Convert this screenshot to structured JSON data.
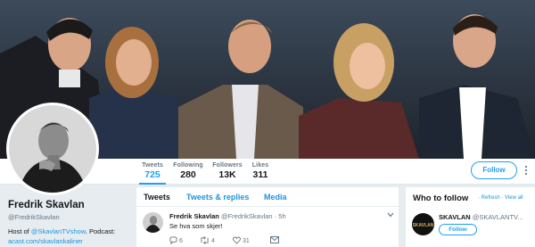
{
  "profile": {
    "name": "Fredrik Skavlan",
    "handle": "@FredrikSkavlan",
    "bio_prefix": "Host of ",
    "bio_link": "@SkavlanTVshow",
    "bio_middle": ". Podcast:",
    "bio_url": "acast.com/skavlankaliner"
  },
  "stats": [
    {
      "label": "Tweets",
      "value": "725"
    },
    {
      "label": "Following",
      "value": "280"
    },
    {
      "label": "Followers",
      "value": "13K"
    },
    {
      "label": "Likes",
      "value": "311"
    }
  ],
  "follow_label": "Follow",
  "more_icon": "vertical-ellipsis-icon",
  "timeline": {
    "tabs": [
      "Tweets",
      "Tweets & replies",
      "Media"
    ],
    "tweet": {
      "name": "Fredrik Skavlan",
      "handle": "@FredrikSkavlan",
      "dot": "·",
      "time": "5h",
      "text": "Se hva som skjer!",
      "reply_count": "6",
      "retweet_count": "4",
      "like_count": "31"
    }
  },
  "who_to_follow": {
    "title": "Who to follow",
    "refresh_prefix": " · ",
    "refresh": "Refresh",
    "view_all": "View all",
    "suggestion": {
      "name": "SKAVLAN",
      "handle": "@SKAVLANTV...",
      "follow_label": "Follow"
    }
  },
  "colors": {
    "accent": "#1da1f2",
    "link": "#1b95e0",
    "page_bg": "#e6ecf0"
  }
}
